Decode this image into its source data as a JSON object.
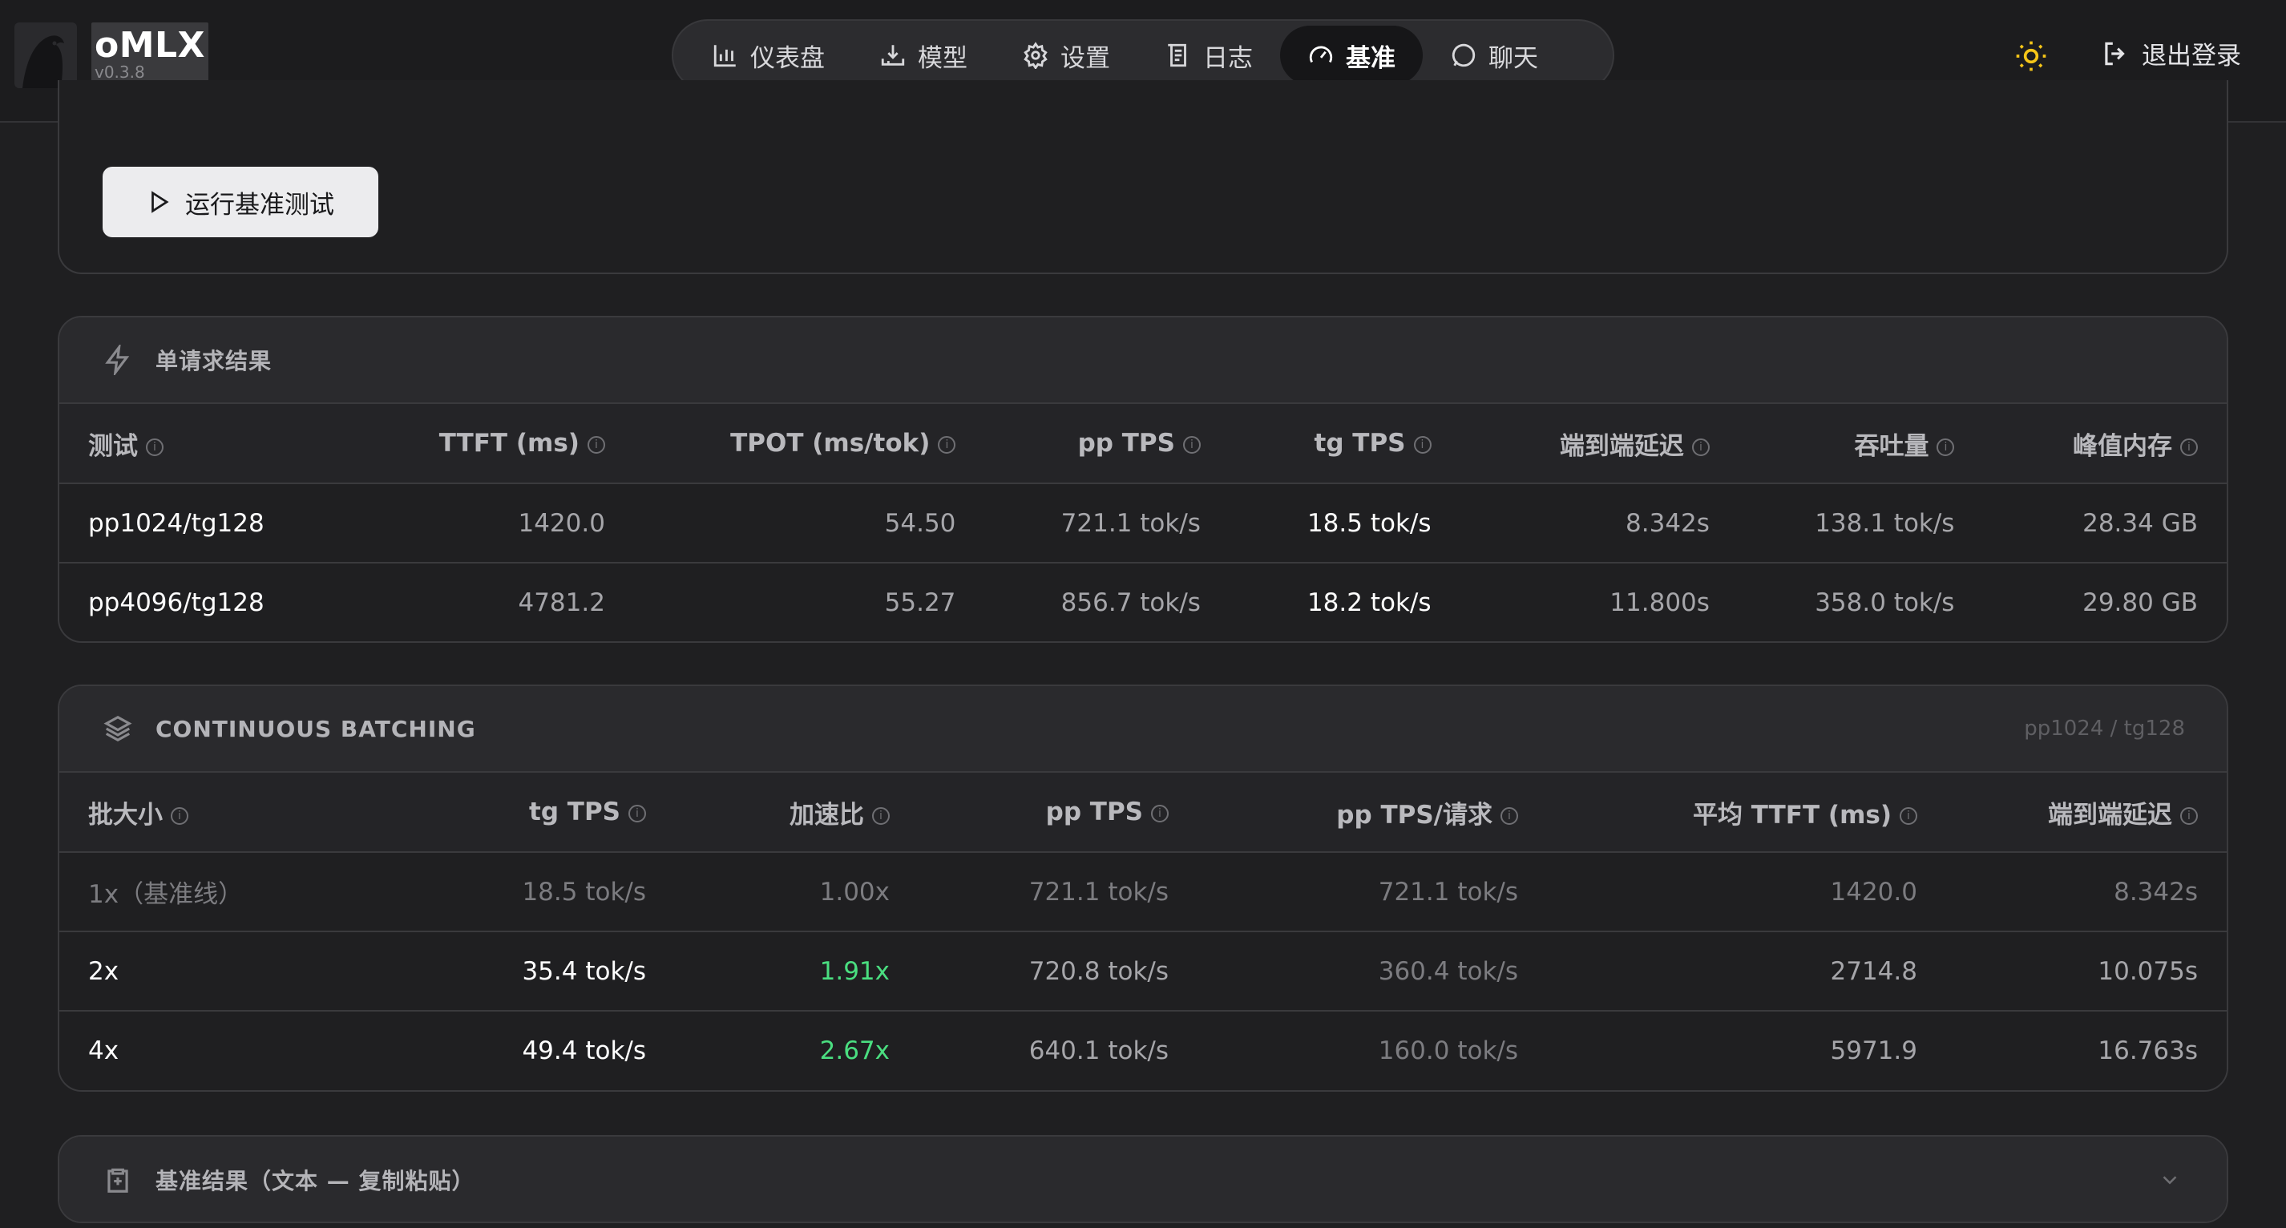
{
  "header": {
    "brand": "oMLX",
    "version": "v0.3.8",
    "nav": [
      {
        "label": "仪表盘",
        "icon": "bar-chart-icon"
      },
      {
        "label": "模型",
        "icon": "download-icon"
      },
      {
        "label": "设置",
        "icon": "gear-icon"
      },
      {
        "label": "日志",
        "icon": "log-icon"
      },
      {
        "label": "基准",
        "icon": "gauge-icon",
        "active": true
      },
      {
        "label": "聊天",
        "icon": "chat-icon"
      }
    ],
    "theme_icon": "sun-icon",
    "logout_label": "退出登录"
  },
  "run_button": {
    "label": "运行基准测试"
  },
  "single": {
    "title": "单请求结果",
    "headers": [
      "测试",
      "TTFT (ms)",
      "TPOT (ms/tok)",
      "pp TPS",
      "tg TPS",
      "端到端延迟",
      "吞吐量",
      "峰值内存"
    ],
    "rows": [
      [
        "pp1024/tg128",
        "1420.0",
        "54.50",
        "721.1 tok/s",
        "18.5 tok/s",
        "8.342s",
        "138.1 tok/s",
        "28.34 GB"
      ],
      [
        "pp4096/tg128",
        "4781.2",
        "55.27",
        "856.7 tok/s",
        "18.2 tok/s",
        "11.800s",
        "358.0 tok/s",
        "29.80 GB"
      ]
    ]
  },
  "batching": {
    "title": "CONTINUOUS BATCHING",
    "subtitle": "pp1024 / tg128",
    "headers": [
      "批大小",
      "tg TPS",
      "加速比",
      "pp TPS",
      "pp TPS/请求",
      "平均 TTFT (ms)",
      "端到端延迟"
    ],
    "rows": [
      [
        "1x（基准线）",
        "18.5 tok/s",
        "1.00x",
        "721.1 tok/s",
        "721.1 tok/s",
        "1420.0",
        "8.342s"
      ],
      [
        "2x",
        "35.4 tok/s",
        "1.91x",
        "720.8 tok/s",
        "360.4 tok/s",
        "2714.8",
        "10.075s"
      ],
      [
        "4x",
        "49.4 tok/s",
        "2.67x",
        "640.1 tok/s",
        "160.0 tok/s",
        "5971.9",
        "16.763s"
      ]
    ]
  },
  "copy_section": {
    "title": "基准结果（文本 — 复制粘贴）"
  },
  "colors": {
    "accent_green": "#4ade80",
    "sun": "#f5c518",
    "background": "#1f1f21"
  }
}
